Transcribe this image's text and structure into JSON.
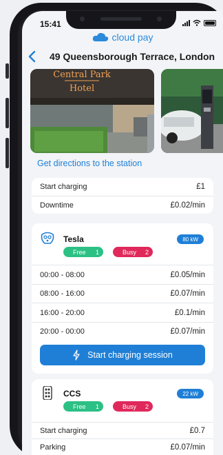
{
  "status": {
    "time": "15:41"
  },
  "brand": {
    "name": "cloud pay"
  },
  "header": {
    "title": "49 Queensborough Terrace, London"
  },
  "photos": {
    "hotel_sign_line1": "Central Park",
    "hotel_sign_line2": "Hotel"
  },
  "directions_link": "Get directions to the station",
  "general_prices": [
    {
      "label": "Start charging",
      "price": "£1"
    },
    {
      "label": "Downtime",
      "price": "£0.02/min"
    }
  ],
  "connectors": [
    {
      "name": "Tesla",
      "power": "80 kW",
      "free_label": "Free",
      "free_count": "1",
      "busy_label": "Busy",
      "busy_count": "2",
      "rates": [
        {
          "time": "00:00 - 08:00",
          "price": "£0.05/min"
        },
        {
          "time": "08:00 - 16:00",
          "price": "£0.07/min"
        },
        {
          "time": "16:00 - 20:00",
          "price": "£0.1/min"
        },
        {
          "time": "20:00 - 00:00",
          "price": "£0.07/min"
        }
      ],
      "cta": "Start charging session"
    },
    {
      "name": "CCS",
      "power": "22 kW",
      "free_label": "Free",
      "free_count": "1",
      "busy_label": "Busy",
      "busy_count": "2",
      "rates": [
        {
          "time": "Start charging",
          "price": "£0.7"
        },
        {
          "time": "Parking",
          "price": "£0.07/min"
        }
      ]
    }
  ],
  "colors": {
    "accent": "#1f7fd6",
    "free": "#2cc084",
    "busy": "#e0295b"
  }
}
